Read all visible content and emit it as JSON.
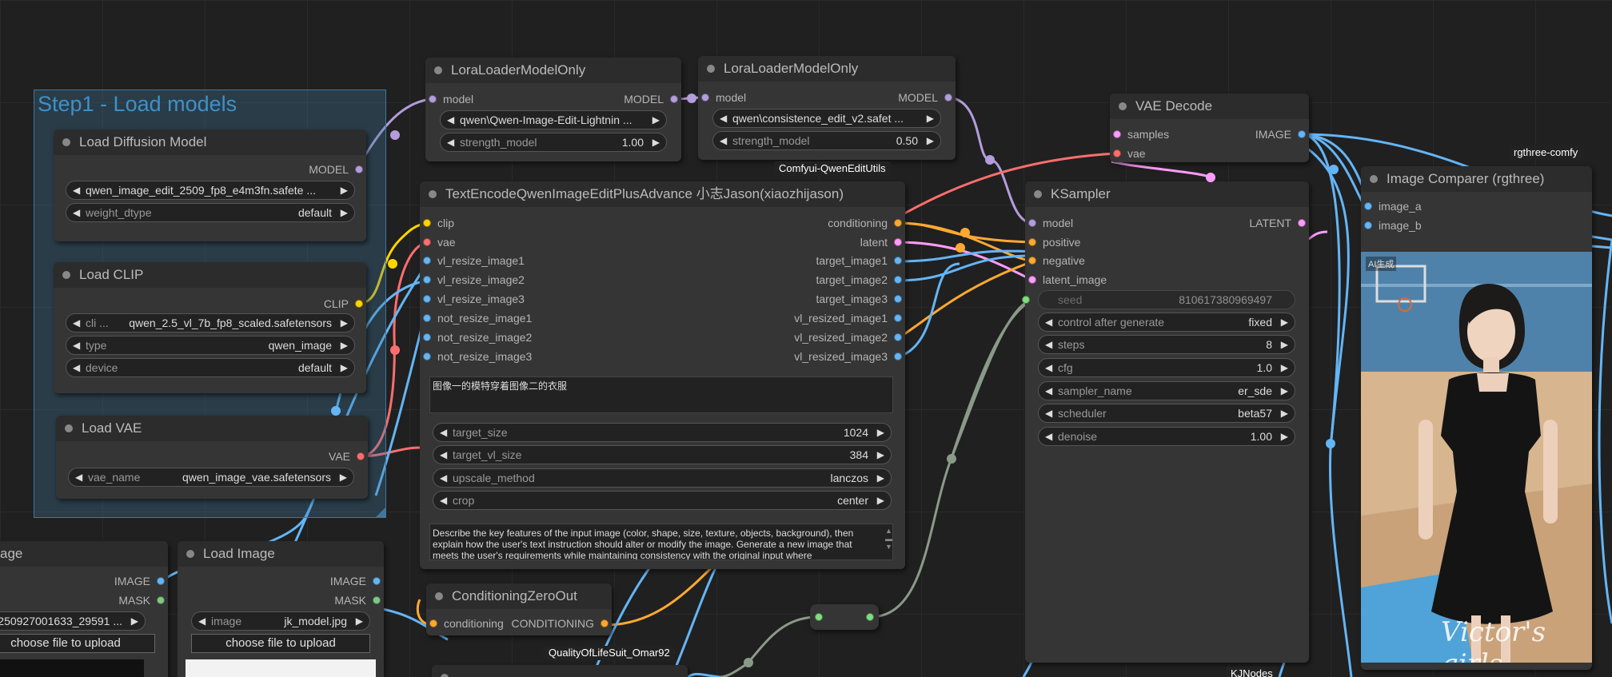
{
  "colors": {
    "model": "#b39ddb",
    "clip": "#ffd500",
    "vae": "#ff6e6e",
    "image": "#64b5f6",
    "latent": "#ff9cf9",
    "conditioning": "#ffa931",
    "mask": "#81c784",
    "int": "#7fdd7f",
    "gray": "#8a9a88"
  },
  "group": {
    "title": "Step1 - Load models"
  },
  "nodes": {
    "lora1": {
      "title": "LoraLoaderModelOnly",
      "in_model": "model",
      "out_model": "MODEL",
      "lora_name": "qwen\\Qwen-Image-Edit-Lightnin ...",
      "strength_label": "strength_model",
      "strength_value": "1.00"
    },
    "lora2": {
      "title": "LoraLoaderModelOnly",
      "in_model": "model",
      "out_model": "MODEL",
      "lora_name": "qwen\\consistence_edit_v2.safet ...",
      "strength_label": "strength_model",
      "strength_value": "0.50"
    },
    "diffusion": {
      "title": "Load Diffusion Model",
      "out": "MODEL",
      "unet_name": "qwen_image_edit_2509_fp8_e4m3fn.safete ...",
      "dtype_label": "weight_dtype",
      "dtype_value": "default"
    },
    "clip": {
      "title": "Load CLIP",
      "out": "CLIP",
      "clip_label": "cli ...",
      "clip_value": "qwen_2.5_vl_7b_fp8_scaled.safetensors",
      "type_label": "type",
      "type_value": "qwen_image",
      "device_label": "device",
      "device_value": "default"
    },
    "vae": {
      "title": "Load VAE",
      "out": "VAE",
      "vae_label": "vae_name",
      "vae_value": "qwen_image_vae.safetensors"
    },
    "encode": {
      "title": "TextEncodeQwenImageEditPlusAdvance 小志Jason(xiaozhijason)",
      "badge": "Comfyui-QwenEditUtils",
      "inputs": [
        "clip",
        "vae",
        "vl_resize_image1",
        "vl_resize_image2",
        "vl_resize_image3",
        "not_resize_image1",
        "not_resize_image2",
        "not_resize_image3"
      ],
      "outputs": [
        "conditioning",
        "latent",
        "target_image1",
        "target_image2",
        "target_image3",
        "vl_resized_image1",
        "vl_resized_image2",
        "vl_resized_image3"
      ],
      "prompt": "图像一的模特穿着图像二的衣服",
      "target_size_label": "target_size",
      "target_size_value": "1024",
      "target_vl_label": "target_vl_size",
      "target_vl_value": "384",
      "upscale_label": "upscale_method",
      "upscale_value": "lanczos",
      "crop_label": "crop",
      "crop_value": "center",
      "system_prompt": "Describe the key features of the input image (color, shape, size, texture, objects, background), then explain how the user's text instruction should alter or modify the image. Generate a new image that meets the user's requirements while maintaining consistency with the original input where"
    },
    "vaedecode": {
      "title": "VAE Decode",
      "in1": "samples",
      "in2": "vae",
      "out": "IMAGE"
    },
    "ksampler": {
      "title": "KSampler",
      "badge": "KJNodes",
      "inputs": [
        "model",
        "positive",
        "negative",
        "latent_image"
      ],
      "out": "LATENT",
      "seed_label": "seed",
      "seed_value": "810617380969497",
      "cag_label": "control after generate",
      "cag_value": "fixed",
      "steps_label": "steps",
      "steps_value": "8",
      "cfg_label": "cfg",
      "cfg_value": "1.0",
      "sampler_label": "sampler_name",
      "sampler_value": "er_sde",
      "scheduler_label": "scheduler",
      "scheduler_value": "beta57",
      "denoise_label": "denoise",
      "denoise_value": "1.00"
    },
    "comparer": {
      "title": "Image Comparer (rgthree)",
      "badge": "rgthree-comfy",
      "in1": "image_a",
      "in2": "image_b",
      "overlay_tag": "AI生成",
      "watermark": "Victor's girls"
    },
    "zeroout": {
      "title": "ConditioningZeroOut",
      "badge": "QualityOfLifeSuit_Omar92",
      "in": "conditioning",
      "out": "CONDITIONING"
    },
    "loadimage1": {
      "title": "age",
      "out1": "IMAGE",
      "out2": "MASK",
      "image_value": "250927001633_29591 ...",
      "upload": "choose file to upload"
    },
    "loadimage2": {
      "title": "Load Image",
      "out1": "IMAGE",
      "out2": "MASK",
      "image_label": "image",
      "image_value": "jk_model.jpg",
      "upload": "choose file to upload"
    }
  }
}
